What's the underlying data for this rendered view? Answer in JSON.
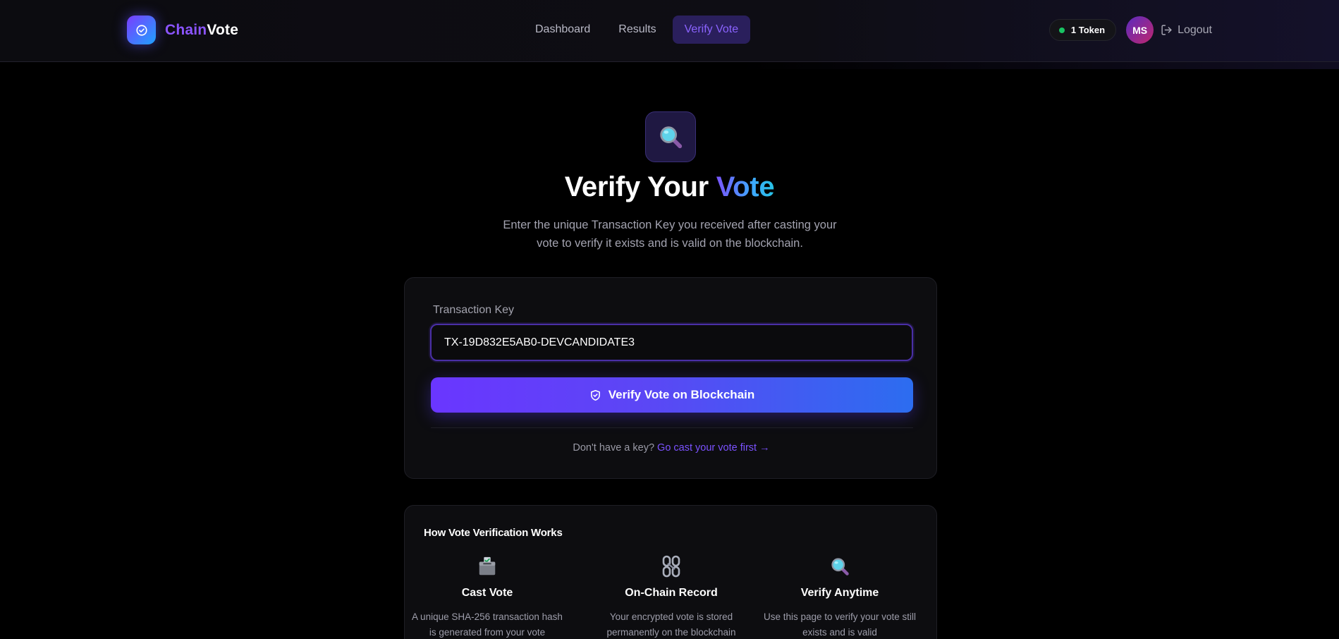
{
  "header": {
    "brand_part1": "Chain",
    "brand_part2": "Vote",
    "nav": {
      "dashboard": "Dashboard",
      "results": "Results",
      "verify": "Verify Vote"
    },
    "token_label": "1 Token",
    "avatar_initials": "MS",
    "logout_label": "Logout"
  },
  "hero": {
    "icon": "magnifier-icon",
    "title_main": "Verify Your ",
    "title_accent": "Vote",
    "subtitle": "Enter the unique Transaction Key you received after casting your vote to verify it exists and is valid on the blockchain."
  },
  "form": {
    "label": "Transaction Key",
    "value": "TX-19D832E5AB0-DEVCANDIDATE3",
    "button_label": "Verify Vote on Blockchain",
    "footer_text": "Don't have a key?",
    "footer_link": "Go cast your vote first →"
  },
  "info": {
    "title": "How Vote Verification Works",
    "steps": [
      {
        "icon": "ballot-box-icon",
        "title": "Cast Vote",
        "desc": "A unique SHA-256 transaction hash is generated from your vote"
      },
      {
        "icon": "chain-link-icon",
        "title": "On-Chain Record",
        "desc": "Your encrypted vote is stored permanently on the blockchain"
      },
      {
        "icon": "magnifier-icon",
        "title": "Verify Anytime",
        "desc": "Use this page to verify your vote still exists and is valid"
      }
    ]
  },
  "colors": {
    "accent": "#7b52ff",
    "accent_blue": "#2c6df0",
    "online": "#19c463",
    "background": "#000000"
  }
}
